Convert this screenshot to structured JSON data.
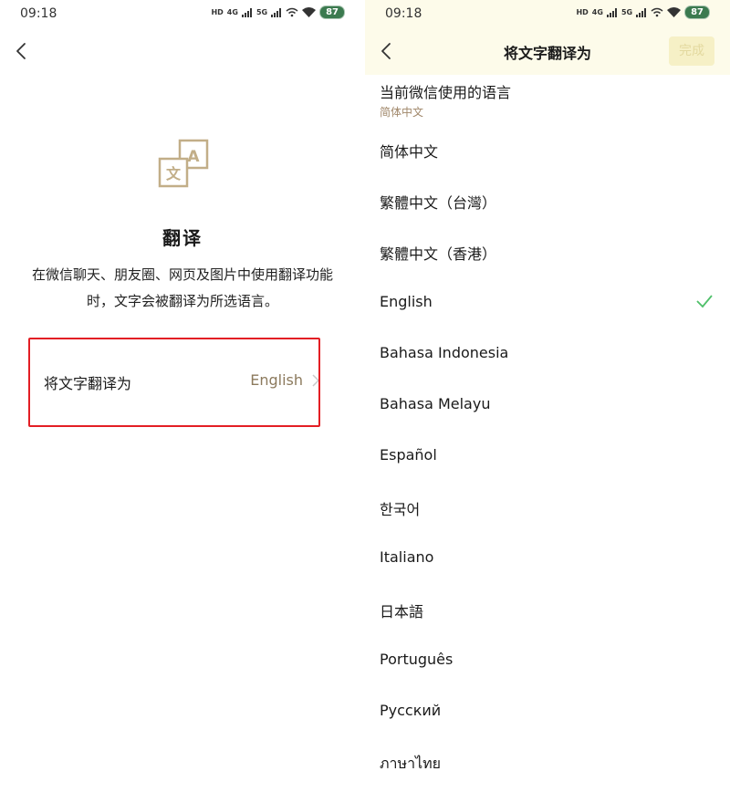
{
  "status_bar": {
    "time": "09:18",
    "hd": "HD",
    "net1": "4G",
    "net2": "5G",
    "battery": "87"
  },
  "left_page": {
    "title": "翻译",
    "description": "在微信聊天、朋友圈、网页及图片中使用翻译功能时，文字会被翻译为所选语言。",
    "setting": {
      "label": "将文字翻译为",
      "value": "English"
    },
    "icon": "translate-icon"
  },
  "right_page": {
    "nav_title": "将文字翻译为",
    "done_label": "完成",
    "current_language": {
      "title": "当前微信使用的语言",
      "value": "简体中文"
    },
    "languages": [
      {
        "name": "简体中文",
        "selected": false
      },
      {
        "name": "繁體中文（台灣）",
        "selected": false
      },
      {
        "name": "繁體中文（香港）",
        "selected": false
      },
      {
        "name": "English",
        "selected": true
      },
      {
        "name": "Bahasa Indonesia",
        "selected": false
      },
      {
        "name": "Bahasa Melayu",
        "selected": false
      },
      {
        "name": "Español",
        "selected": false
      },
      {
        "name": "한국어",
        "selected": false
      },
      {
        "name": "Italiano",
        "selected": false
      },
      {
        "name": "日本語",
        "selected": false
      },
      {
        "name": "Português",
        "selected": false
      },
      {
        "name": "Русский",
        "selected": false
      },
      {
        "name": "ภาษาไทย",
        "selected": false
      }
    ]
  },
  "colors": {
    "accent_text": "#8c7a5d",
    "highlight_box": "#e31e24",
    "check": "#4fc06a",
    "header_bg": "#fdfbea"
  }
}
